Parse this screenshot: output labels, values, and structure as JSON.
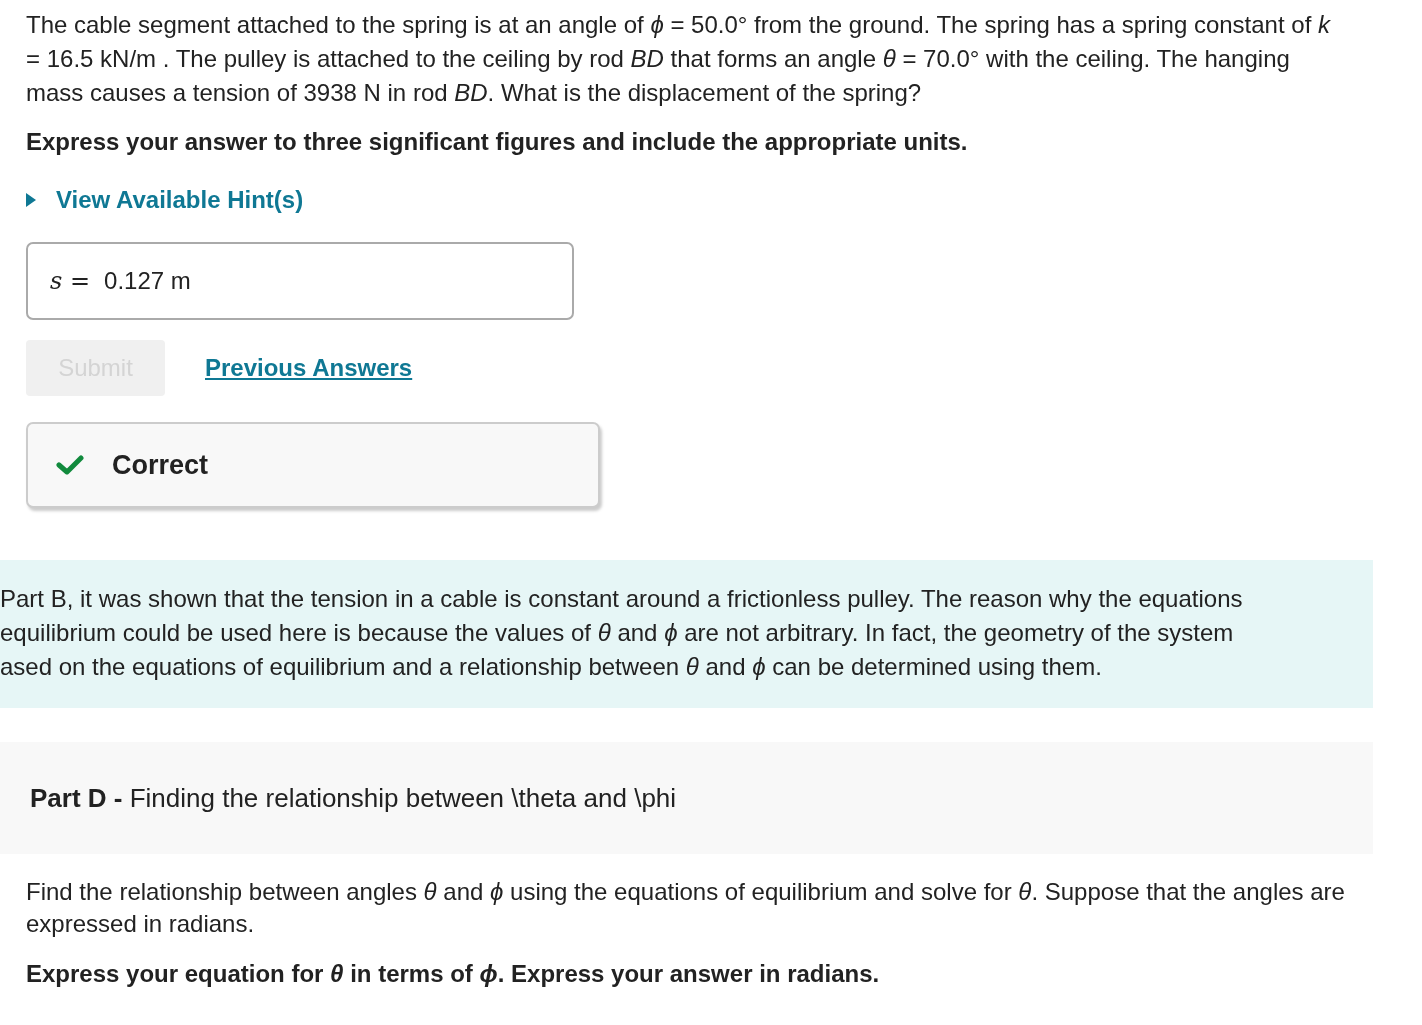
{
  "question": {
    "paragraph": "The cable segment attached to the spring is at an angle of *ϕ* = 50.0°  from the ground. The spring has a spring constant of *k* = 16.5 kN/m . The pulley is attached to the ceiling by rod *BD* that forms an angle *θ* = 70.0°  with the ceiling. The hanging mass causes a tension of 3938 N in rod  *BD*. What is the displacement of the spring?",
    "instruction": "Express your answer to three significant figures and include the appropriate units."
  },
  "hint_toggle": {
    "label": "View Available Hint(s)",
    "expanded": false
  },
  "answer": {
    "variable": "s =",
    "value": "0.127 m"
  },
  "submit": {
    "label": "Submit",
    "disabled": true
  },
  "previous_answers_link": "Previous Answers",
  "feedback": {
    "kind": "correct",
    "label": "Correct"
  },
  "explanation_lines": [
    "Part B, it was shown that the tension in a cable is constant around a frictionless pulley. The reason why the equations",
    "equilibrium could be used here is because the values of *θ* and *ϕ* are not arbitrary. In fact, the geometry of the system",
    "ased on the equations of equilibrium and a relationship between *θ* and *ϕ* can be determined using them."
  ],
  "part": {
    "label": "Part D -",
    "title": "Finding the relationship between \\theta and \\phi"
  },
  "part_question": "Find the relationship between angles *θ* and *ϕ* using the equations of equilibrium and solve for *θ*. Suppose that the angles are expressed in radians.",
  "part_instruction": "Express your equation for *θ* in terms of *ϕ*. Express your answer in radians."
}
